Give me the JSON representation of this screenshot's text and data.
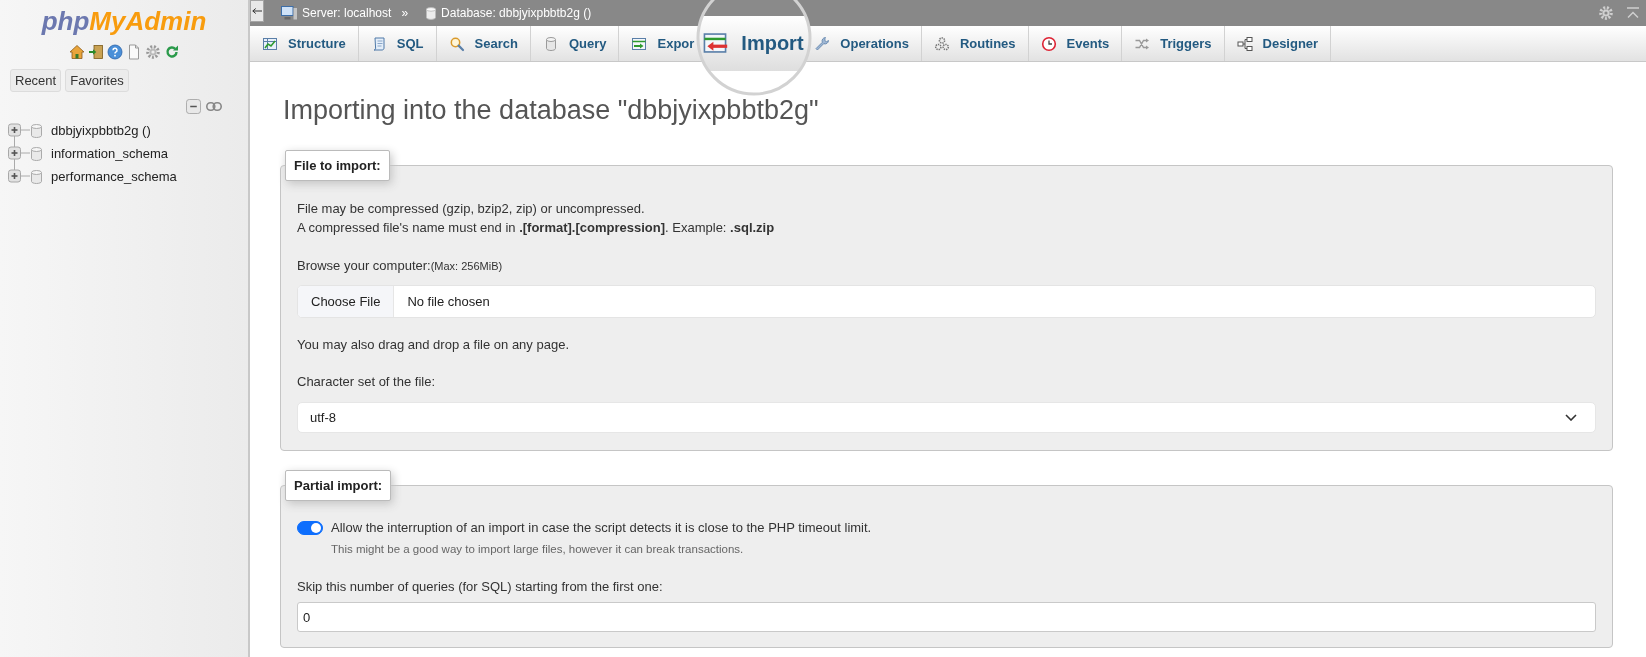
{
  "sidebar": {
    "logo": [
      "php",
      "MyAdmin"
    ],
    "buttons": [
      {
        "label": "Recent"
      },
      {
        "label": "Favorites"
      }
    ],
    "tree": [
      {
        "label": "dbbjyixpbbtb2g ()",
        "expanded": false,
        "selected": false
      },
      {
        "label": "information_schema",
        "expanded": false,
        "selected": false
      },
      {
        "label": "performance_schema",
        "expanded": false,
        "selected": false
      }
    ]
  },
  "breadcrumb": {
    "items": [
      "Server: localhost",
      "Database: dbbjyixpbbtb2g ()"
    ],
    "separator": "»"
  },
  "tabs": [
    {
      "label": "Structure",
      "selected": false
    },
    {
      "label": "SQL",
      "selected": false
    },
    {
      "label": "Search",
      "selected": false
    },
    {
      "label": "Query",
      "selected": false
    },
    {
      "label": "Expor",
      "selected": false
    },
    {
      "label": "Import",
      "selected": true
    },
    {
      "label": "Operations",
      "selected": false
    },
    {
      "label": "Routines",
      "selected": false
    },
    {
      "label": "Events",
      "selected": false
    },
    {
      "label": "Triggers",
      "selected": false
    },
    {
      "label": "Designer",
      "selected": false
    }
  ],
  "heading": "Importing into the database \"dbbjyixpbbtb2g\"",
  "file_to_import": {
    "legend": "File to import:",
    "note": "File may be compressed (gzip, bzip2, zip) or uncompressed.",
    "note_2": "A compressed file's name must end in **.[format].[compression]**. Example: **.sql.zip**",
    "browse_label": "Browse your computer:",
    "max_size": "(Max: 256MiB)",
    "choose_button": "Choose File",
    "file_status": "No file chosen",
    "drag_hint": "You may also drag and drop a file on any page.",
    "charset_label": "Character set of the file:",
    "charset_value": "utf-8"
  },
  "partial_import": {
    "legend": "Partial import:",
    "allow_interrupt": {
      "label": "Allow the interruption of an import in case the script detects it is close to the PHP timeout limit.",
      "on": true
    },
    "help": "This might be a good way to import large files, however it can break transactions.",
    "skip_label": "Skip this number of queries (for SQL) starting from the first one:",
    "skip_value": "0"
  }
}
